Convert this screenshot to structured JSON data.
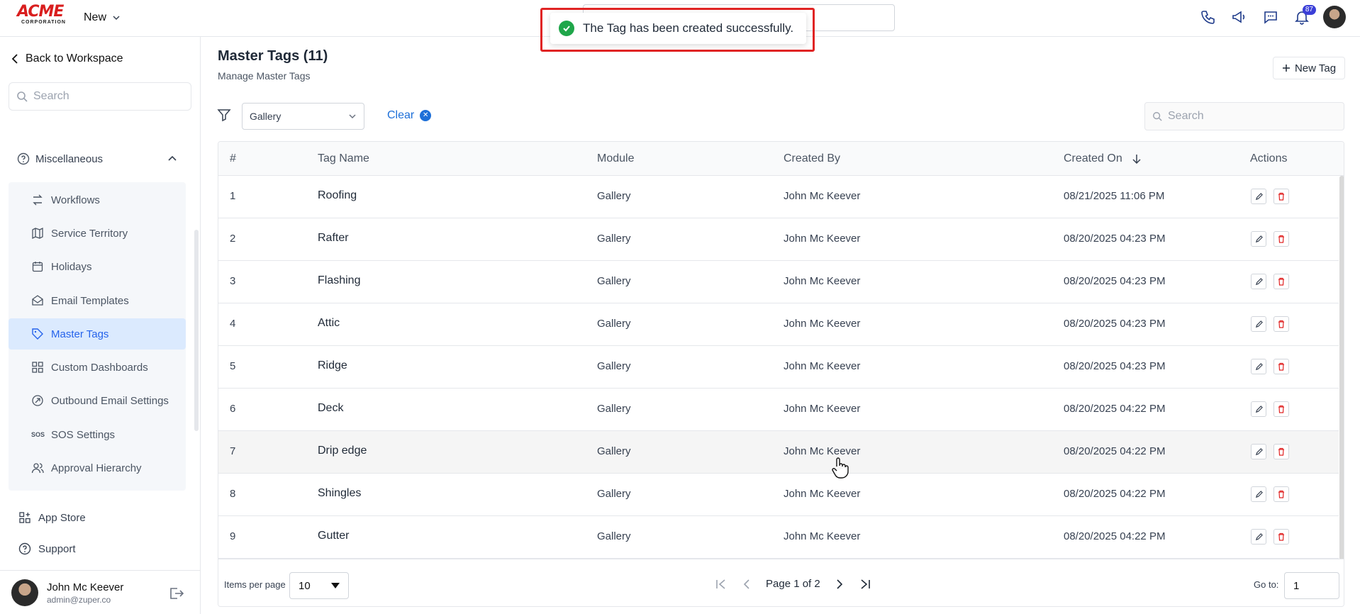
{
  "topbar": {
    "logo_text": "ACME",
    "logo_sub": "CORPORATION",
    "new_label": "New",
    "notification_count": "87"
  },
  "toast": {
    "message": "The Tag has been created successfully."
  },
  "sidebar": {
    "back_label": "Back to Workspace",
    "search_placeholder": "Search",
    "section_label": "Miscellaneous",
    "items": [
      {
        "label": "Workflows",
        "icon": "workflows-icon"
      },
      {
        "label": "Service Territory",
        "icon": "map-icon"
      },
      {
        "label": "Holidays",
        "icon": "calendar-icon"
      },
      {
        "label": "Email Templates",
        "icon": "email-icon"
      },
      {
        "label": "Master Tags",
        "icon": "tag-icon",
        "active": true
      },
      {
        "label": "Custom Dashboards",
        "icon": "dashboard-icon"
      },
      {
        "label": "Outbound Email Settings",
        "icon": "outbound-icon"
      },
      {
        "label": "SOS Settings",
        "icon": "sos-icon"
      },
      {
        "label": "Approval Hierarchy",
        "icon": "users-icon"
      }
    ],
    "app_store_label": "App Store",
    "support_label": "Support",
    "user_name": "John Mc Keever",
    "user_email": "admin@zuper.co"
  },
  "main": {
    "title": "Master Tags (11)",
    "subtitle": "Manage Master Tags",
    "new_tag_label": "New Tag",
    "filter_value": "Gallery",
    "clear_label": "Clear",
    "search_placeholder": "Search"
  },
  "table": {
    "headers": {
      "num": "#",
      "name": "Tag Name",
      "module": "Module",
      "created_by": "Created By",
      "created_on": "Created On",
      "actions": "Actions"
    },
    "rows": [
      {
        "num": "1",
        "name": "Roofing",
        "module": "Gallery",
        "created_by": "John Mc Keever",
        "created_on": "08/21/2025 11:06 PM"
      },
      {
        "num": "2",
        "name": "Rafter",
        "module": "Gallery",
        "created_by": "John Mc Keever",
        "created_on": "08/20/2025 04:23 PM"
      },
      {
        "num": "3",
        "name": "Flashing",
        "module": "Gallery",
        "created_by": "John Mc Keever",
        "created_on": "08/20/2025 04:23 PM"
      },
      {
        "num": "4",
        "name": "Attic",
        "module": "Gallery",
        "created_by": "John Mc Keever",
        "created_on": "08/20/2025 04:23 PM"
      },
      {
        "num": "5",
        "name": "Ridge",
        "module": "Gallery",
        "created_by": "John Mc Keever",
        "created_on": "08/20/2025 04:23 PM"
      },
      {
        "num": "6",
        "name": "Deck",
        "module": "Gallery",
        "created_by": "John Mc Keever",
        "created_on": "08/20/2025 04:22 PM"
      },
      {
        "num": "7",
        "name": "Drip edge",
        "module": "Gallery",
        "created_by": "John Mc Keever",
        "created_on": "08/20/2025 04:22 PM"
      },
      {
        "num": "8",
        "name": "Shingles",
        "module": "Gallery",
        "created_by": "John Mc Keever",
        "created_on": "08/20/2025 04:22 PM"
      },
      {
        "num": "9",
        "name": "Gutter",
        "module": "Gallery",
        "created_by": "John Mc Keever",
        "created_on": "08/20/2025 04:22 PM"
      }
    ],
    "footer": {
      "items_per_page_label": "Items per page",
      "items_per_page_value": "10",
      "page_text": "Page 1 of 2",
      "goto_label": "Go to:",
      "goto_value": "1"
    }
  },
  "colors": {
    "accent": "#2563eb",
    "toast_border": "#e02424",
    "success": "#1fa64a",
    "delete": "#e02424"
  }
}
